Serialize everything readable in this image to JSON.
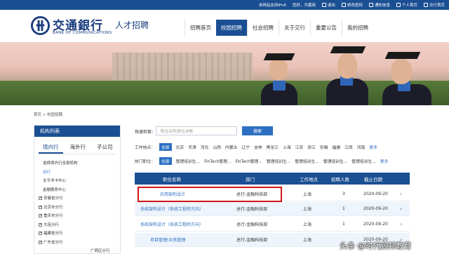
{
  "topbar": {
    "ipv6": "本网站支持IPv6",
    "welcome": "您好，冯嘉硕",
    "logout": "退出",
    "password": "修改密码",
    "notice": "通知信息",
    "mine": "个人首页",
    "home": "交行首页"
  },
  "logo": {
    "cn": "交通銀行",
    "en": "BANK OF COMMUNICATIONS",
    "sub": "人才招聘"
  },
  "nav": [
    "招聘首页",
    "校园招聘",
    "社会招聘",
    "关于交行",
    "重要公告",
    "我的招聘"
  ],
  "nav_active": "校园招聘",
  "breadcrumb": "首页 > 校园招聘",
  "sidebar": {
    "title": "机构列表",
    "tabs": [
      "境内行",
      "海外行",
      "子公司"
    ],
    "items": [
      {
        "label": "选择境内行全部机构",
        "expandable": false,
        "color": "#333333"
      },
      {
        "label": "总行",
        "expandable": false,
        "color": "#2d6fc2"
      },
      {
        "label": "太平洋卡中心",
        "expandable": false,
        "color": "#333333"
      },
      {
        "label": "金融服务中心",
        "expandable": false,
        "color": "#333333"
      },
      {
        "label": "安徽省分行",
        "expandable": true,
        "color": "#333333"
      },
      {
        "label": "北京市分行",
        "expandable": true,
        "color": "#333333"
      },
      {
        "label": "重庆市分行",
        "expandable": true,
        "color": "#333333"
      },
      {
        "label": "大连分行",
        "expandable": true,
        "color": "#333333"
      },
      {
        "label": "福建省分行",
        "expandable": true,
        "color": "#333333"
      },
      {
        "label": "广东省分行",
        "expandable": true,
        "color": "#333333"
      }
    ],
    "extra": "广西区分行"
  },
  "search": {
    "label": "快速检索：",
    "placeholder": "职位名称/职位详情",
    "button": "搜索"
  },
  "filters": {
    "location_label": "工作地点：",
    "locations": [
      "全部",
      "北京",
      "天津",
      "河北",
      "山西",
      "内蒙古",
      "辽宁",
      "吉林",
      "黑龙江",
      "上海",
      "江苏",
      "浙江",
      "安徽",
      "福建",
      "江西",
      "河南"
    ],
    "position_label": "热门职位：",
    "positions": [
      "全部",
      "管理培训生...",
      "FinTech管理...",
      "FinTech管理...",
      "管理培训生...",
      "管理培训生...",
      "管理培训生...",
      "管理培训生..."
    ],
    "more": "更多"
  },
  "table": {
    "headers": [
      "职位名称",
      "部门",
      "工作地点",
      "招聘人数",
      "截止日期"
    ],
    "rows": [
      {
        "title": "应用架构设计",
        "dept": "总行-金融科技部",
        "loc": "上海",
        "count": "3",
        "date": "2020-09-20"
      },
      {
        "title": "系统架构设计（系统工程师方向）",
        "dept": "总行-金融科技部",
        "loc": "上海",
        "count": "1",
        "date": "2020-09-20"
      },
      {
        "title": "系统架构设计（系统工程师方向）",
        "dept": "总行-金融科技部",
        "loc": "上海",
        "count": "1",
        "date": "2020-09-20"
      },
      {
        "title": "项目管理(业务管理",
        "dept": "总行-金融科技部",
        "loc": "上海",
        "count": "",
        "date": "2020-09-20"
      }
    ]
  },
  "watermark": "头条 @时代顾邦教育"
}
